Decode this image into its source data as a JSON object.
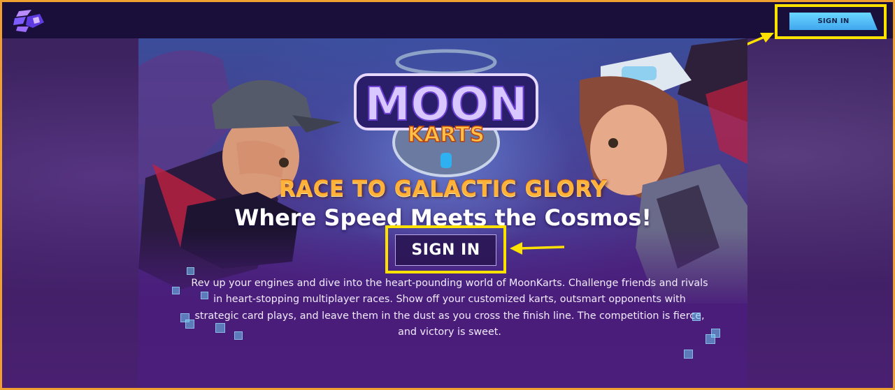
{
  "header": {
    "logo_icon": "site-logo-icon",
    "signin_label": "SIGN IN"
  },
  "hero": {
    "game_logo": {
      "line1": "MOON",
      "line2": "KARTS"
    },
    "tagline": "RACE TO GALACTIC GLORY",
    "subtitle": "Where Speed Meets the Cosmos!",
    "cta_label": "SIGN IN",
    "description_lines": [
      "Rev up your engines and dive into the heart-pounding world of MoonKarts. Challenge friends and rivals",
      "in heart-stopping multiplayer races. Show off your customized karts, outsmart opponents with",
      "strategic card plays, and leave them in the dust as you cross the finish line. The competition is fierce,",
      "and victory is sweet."
    ]
  },
  "colors": {
    "frame_border": "#f0a030",
    "highlight": "#ffe100",
    "header_bg": "#1a0f3a",
    "signin_button": "#4fb8f5",
    "tagline": "#ffb23a"
  }
}
